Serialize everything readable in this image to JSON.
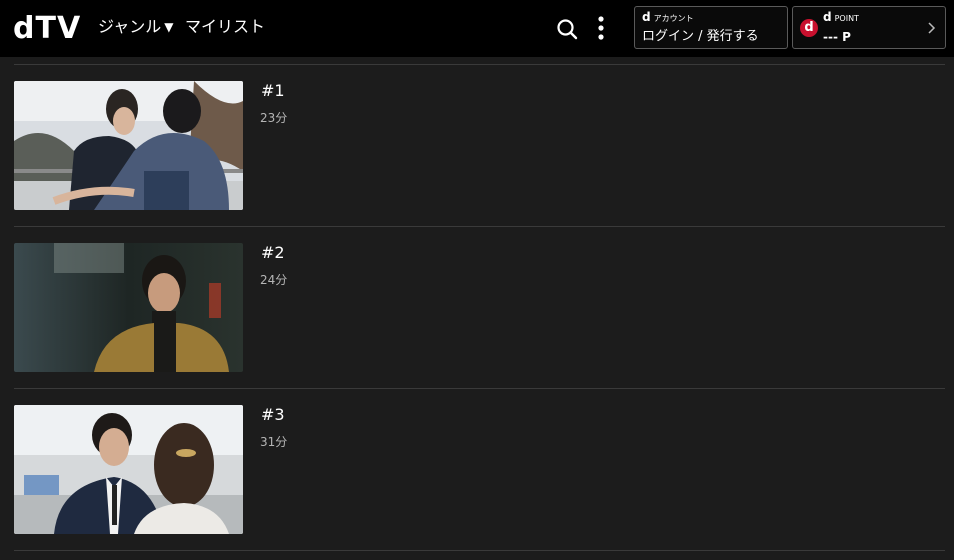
{
  "header": {
    "logo": "dTV",
    "nav": {
      "genre": "ジャンル",
      "mylist": "マイリスト"
    },
    "account": {
      "small_label": "アカウント",
      "action": "ログイン / 発行する"
    },
    "point": {
      "small_label": "POINT",
      "value": "--- P"
    }
  },
  "episodes": [
    {
      "title": "#1",
      "duration": "23分"
    },
    {
      "title": "#2",
      "duration": "24分"
    },
    {
      "title": "#3",
      "duration": "31分"
    }
  ],
  "colors": {
    "header_bg": "#000000",
    "page_bg": "#1c1c1c",
    "dpoint_red": "#c8102e"
  }
}
